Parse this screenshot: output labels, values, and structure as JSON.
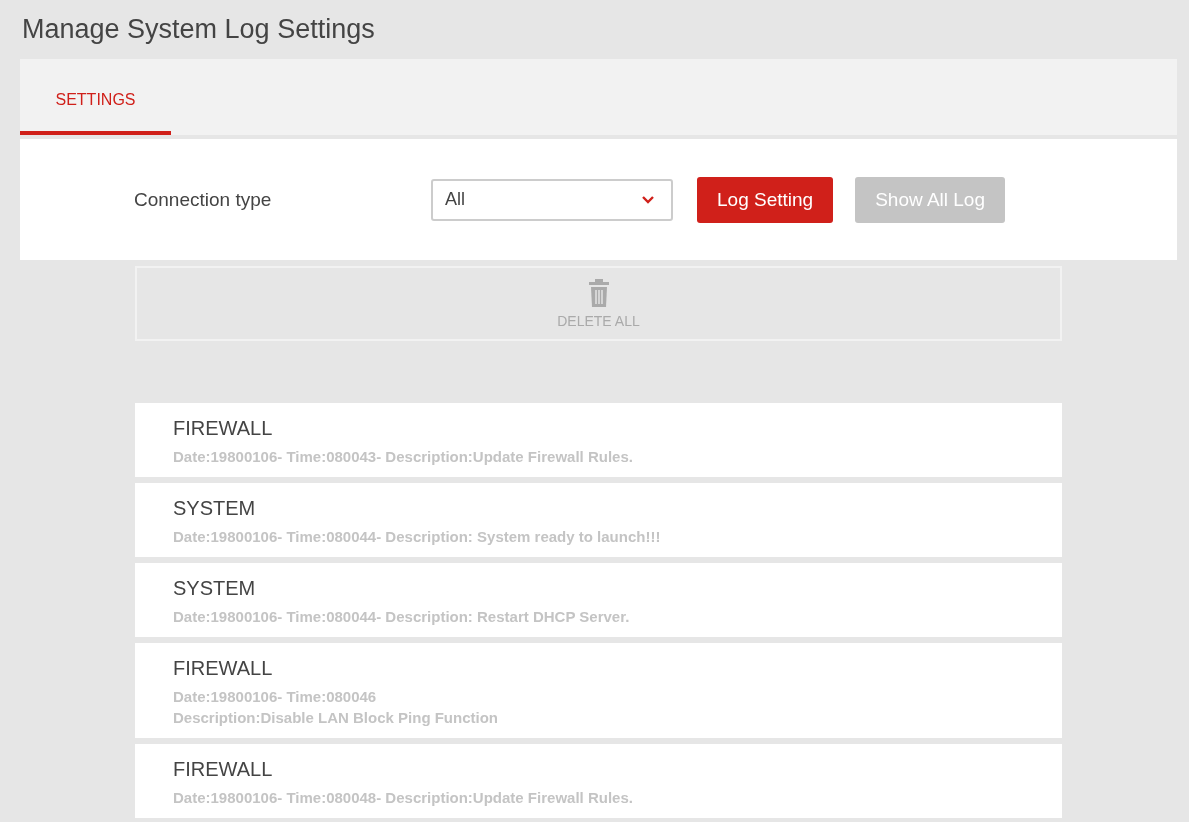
{
  "page_title": "Manage System Log Settings",
  "tabs": [
    {
      "label": "SETTINGS",
      "selected": true
    }
  ],
  "filter": {
    "label": "Connection type",
    "select_value": "All"
  },
  "buttons": [
    {
      "label": "Log Setting",
      "disabled": false
    },
    {
      "label": "Show All Log",
      "disabled": true
    }
  ],
  "delete_all": {
    "label": "DELETE ALL"
  },
  "logs": [
    {
      "category": "FIREWALL",
      "lines": [
        "Date:19800106- Time:080043- Description:Update Firewall Rules."
      ]
    },
    {
      "category": "SYSTEM",
      "lines": [
        "Date:19800106- Time:080044- Description: System ready to launch!!!"
      ]
    },
    {
      "category": "SYSTEM",
      "lines": [
        "Date:19800106- Time:080044- Description: Restart DHCP Server."
      ]
    },
    {
      "category": "FIREWALL",
      "lines": [
        "Date:19800106- Time:080046",
        "Description:Disable LAN Block Ping Function"
      ]
    },
    {
      "category": "FIREWALL",
      "lines": [
        "Date:19800106- Time:080048- Description:Update Firewall Rules."
      ]
    }
  ]
}
